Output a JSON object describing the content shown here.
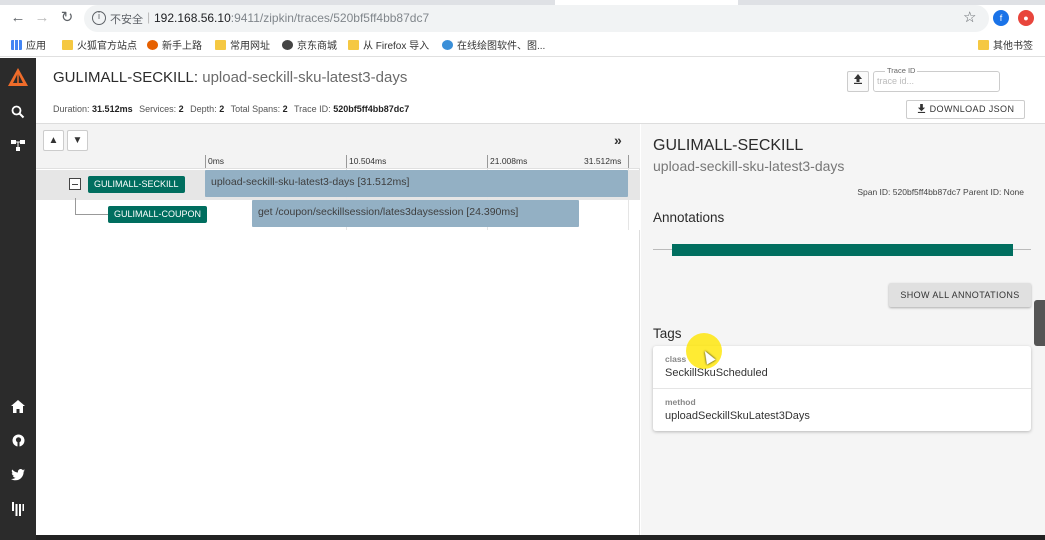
{
  "browser": {
    "security": "不安全",
    "url_host": "192.168.56.10",
    "url_rest": ":9411/zipkin/traces/520bf5ff4bb87dc7",
    "bookmarks": [
      "应用",
      "火狐官方站点",
      "新手上路",
      "常用网址",
      "京东商城",
      "从 Firefox 导入",
      "在线绘图软件、图...",
      "其他书签"
    ]
  },
  "header": {
    "service_name": "GULIMALL-SECKILL:",
    "span_name": "upload-seckill-sku-latest3-days",
    "meta": {
      "duration_label": "Duration:",
      "duration": "31.512ms",
      "services_label": "Services:",
      "services": "2",
      "depth_label": "Depth:",
      "depth": "2",
      "spans_label": "Total Spans:",
      "spans": "2",
      "traceid_label": "Trace ID:",
      "traceid": "520bf5ff4bb87dc7"
    },
    "trace_id_label": "Trace ID",
    "trace_id_placeholder": "trace id...",
    "download_label": "DOWNLOAD JSON"
  },
  "timeline": {
    "ticks": [
      "0ms",
      "10.504ms",
      "21.008ms",
      "31.512ms"
    ],
    "spans": [
      {
        "service": "GULIMALL-SECKILL",
        "label": "upload-seckill-sku-latest3-days [31.512ms]",
        "start_ms": 0,
        "duration_ms": 31.512,
        "depth": 0
      },
      {
        "service": "GULIMALL-COUPON",
        "label": "get /coupon/seckillsession/lates3daysession [24.390ms]",
        "start_ms": 3.5,
        "duration_ms": 24.39,
        "depth": 1
      }
    ]
  },
  "detail": {
    "service": "GULIMALL-SECKILL",
    "span": "upload-seckill-sku-latest3-days",
    "ids": "Span ID: 520bf5ff4bb87dc7   Parent ID: None",
    "annotations_title": "Annotations",
    "show_all_label": "SHOW ALL ANNOTATIONS",
    "tags_title": "Tags",
    "tags": [
      {
        "key": "class",
        "value": "SeckillSkuScheduled"
      },
      {
        "key": "method",
        "value": "uploadSeckillSkuLatest3Days"
      }
    ]
  },
  "colors": {
    "badge": "#006e5f",
    "span_bar": "#93b0c4",
    "sidebar": "#2b2b2b",
    "logo_orange": "#f06c2a"
  }
}
